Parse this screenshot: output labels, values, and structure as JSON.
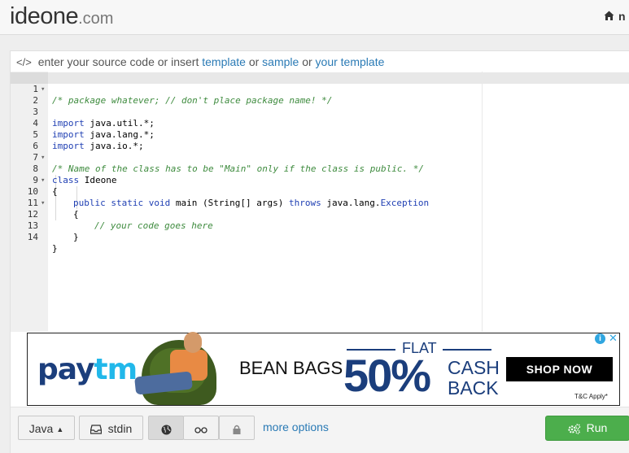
{
  "header": {
    "logo_main": "ideone",
    "logo_domain": ".com",
    "home_initial": "n"
  },
  "hint": {
    "prefix": "enter your source code or insert",
    "template_link": "template",
    "or1": "or",
    "sample_link": "sample",
    "or2": "or",
    "your_template_link": "your template"
  },
  "editor": {
    "lines": [
      {
        "n": "1",
        "fold": true
      },
      {
        "n": "2",
        "fold": false
      },
      {
        "n": "3",
        "fold": false
      },
      {
        "n": "4",
        "fold": false
      },
      {
        "n": "5",
        "fold": false
      },
      {
        "n": "6",
        "fold": false
      },
      {
        "n": "7",
        "fold": true
      },
      {
        "n": "8",
        "fold": false
      },
      {
        "n": "9",
        "fold": true
      },
      {
        "n": "10",
        "fold": false
      },
      {
        "n": "11",
        "fold": true
      },
      {
        "n": "12",
        "fold": false
      },
      {
        "n": "13",
        "fold": false
      },
      {
        "n": "14",
        "fold": false
      }
    ],
    "code": {
      "l1": "/* package whatever; // don't place package name! */",
      "l3_kw": "import",
      "l3_rest": " java.util.*;",
      "l4_kw": "import",
      "l4_rest": " java.lang.*;",
      "l5_kw": "import",
      "l5_rest": " java.io.*;",
      "l7": "/* Name of the class has to be \"Main\" only if the class is public. */",
      "l8_kw": "class",
      "l8_rest": " Ideone",
      "l9": "{",
      "l10_kw1": "public",
      "l10_sp1": " ",
      "l10_kw2": "static",
      "l10_sp2": " ",
      "l10_kw3": "void",
      "l10_mid": " main (String[] args) ",
      "l10_kw4": "throws",
      "l10_pre": " java.lang.",
      "l10_ty": "Exception",
      "l11": "{",
      "l12": "// your code goes here",
      "l13": "}",
      "l14": "}"
    }
  },
  "ad": {
    "brand_main": "pay",
    "brand_accent": "tm",
    "product": "BEAN BAGS",
    "flat": "FLAT",
    "percent": "50%",
    "cash": "CASH",
    "back": "BACK",
    "cta": "SHOP NOW",
    "terms": "T&C Apply*",
    "info_icon": "i",
    "close_icon": "✕"
  },
  "toolbar": {
    "language": "Java",
    "stdin": "stdin",
    "more_options": "more options",
    "run": "Run"
  },
  "colors": {
    "link": "#2a7ab5",
    "run_button": "#4cae4c",
    "keyword": "#1f3fb3",
    "comment": "#3e8b3e",
    "paytm_blue": "#1b3e7c",
    "paytm_cyan": "#22b8ea"
  }
}
